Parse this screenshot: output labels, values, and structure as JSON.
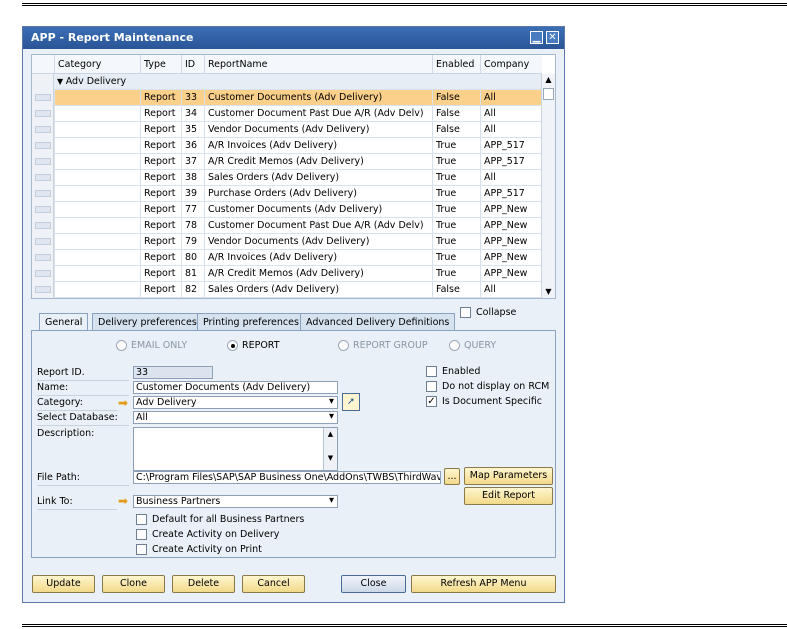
{
  "window": {
    "title": "APP - Report Maintenance"
  },
  "grid": {
    "columns": [
      "Category",
      "Type",
      "ID",
      "ReportName",
      "Enabled",
      "Company"
    ],
    "group_label": "Adv Delivery",
    "rows": [
      {
        "type": "Report",
        "id": "33",
        "name": "Customer Documents  (Adv Delivery)",
        "enabled": "False",
        "company": "All"
      },
      {
        "type": "Report",
        "id": "34",
        "name": "Customer Document Past Due A/R (Adv Delv)",
        "enabled": "False",
        "company": "All"
      },
      {
        "type": "Report",
        "id": "35",
        "name": "Vendor Documents (Adv Delivery)",
        "enabled": "False",
        "company": "All"
      },
      {
        "type": "Report",
        "id": "36",
        "name": "A/R Invoices (Adv Delivery)",
        "enabled": "True",
        "company": "APP_517"
      },
      {
        "type": "Report",
        "id": "37",
        "name": "A/R Credit Memos (Adv Delivery)",
        "enabled": "True",
        "company": "APP_517"
      },
      {
        "type": "Report",
        "id": "38",
        "name": "Sales Orders (Adv Delivery)",
        "enabled": "True",
        "company": "All"
      },
      {
        "type": "Report",
        "id": "39",
        "name": "Purchase Orders (Adv Delivery)",
        "enabled": "True",
        "company": "APP_517"
      },
      {
        "type": "Report",
        "id": "77",
        "name": "Customer Documents  (Adv Delivery)",
        "enabled": "True",
        "company": "APP_New"
      },
      {
        "type": "Report",
        "id": "78",
        "name": "Customer Document Past Due A/R (Adv Delv)",
        "enabled": "True",
        "company": "APP_New"
      },
      {
        "type": "Report",
        "id": "79",
        "name": "Vendor Documents (Adv Delivery)",
        "enabled": "True",
        "company": "APP_New"
      },
      {
        "type": "Report",
        "id": "80",
        "name": "A/R Invoices (Adv Delivery)",
        "enabled": "True",
        "company": "APP_New"
      },
      {
        "type": "Report",
        "id": "81",
        "name": "A/R Credit Memos (Adv Delivery)",
        "enabled": "True",
        "company": "APP_New"
      },
      {
        "type": "Report",
        "id": "82",
        "name": "Sales Orders (Adv Delivery)",
        "enabled": "False",
        "company": "All"
      }
    ]
  },
  "collapse_label": "Collapse",
  "tabs": [
    "General",
    "Delivery preferences",
    "Printing preferences",
    "Advanced Delivery Definitions"
  ],
  "radios": [
    "EMAIL ONLY",
    "REPORT",
    "REPORT GROUP",
    "QUERY"
  ],
  "form": {
    "report_id_label": "Report ID.",
    "report_id": "33",
    "name_label": "Name:",
    "name": "Customer Documents  (Adv Delivery)",
    "category_label": "Category:",
    "category": "Adv Delivery",
    "database_label": "Select Database:",
    "database": "All",
    "description_label": "Description:",
    "file_path_label": "File Path:",
    "file_path": "C:\\Program Files\\SAP\\SAP Business One\\AddOns\\TWBS\\ThirdWave",
    "link_to_label": "Link To:",
    "link_to": "Business Partners",
    "browse": "...",
    "map_parameters": "Map Parameters",
    "edit_report": "Edit Report",
    "enabled": "Enabled",
    "no_rcm": "Do not display on RCM",
    "doc_specific": "Is Document Specific",
    "default_bp": "Default for all Business Partners",
    "activity_delivery": "Create Activity on Delivery",
    "activity_print": "Create Activity on Print"
  },
  "buttons": {
    "update": "Update",
    "clone": "Clone",
    "delete": "Delete",
    "cancel": "Cancel",
    "close": "Close",
    "refresh": "Refresh APP Menu"
  }
}
